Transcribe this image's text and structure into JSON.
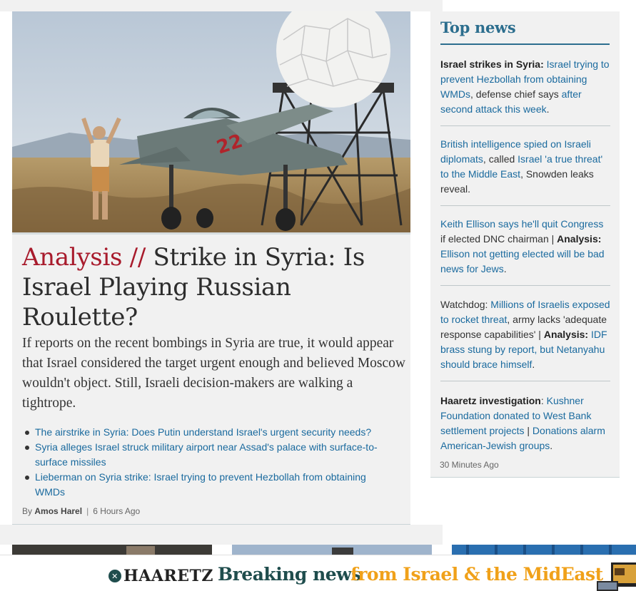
{
  "lead": {
    "kicker": "Analysis //",
    "title": " Strike in Syria: Is Israel Playing Russian Roulette?",
    "summary": "If reports on the recent bombings in Syria are true, it would appear that Israel considered the target urgent enough and believed Moscow wouldn't object. Still, Israeli decision-makers are walking a tightrope.",
    "related": [
      "The airstrike in Syria: Does Putin understand Israel's urgent security needs?",
      "Syria alleges Israel struck military airport near Assad's palace with surface-to-surface missiles",
      "Lieberman on Syria strike: Israel trying to prevent Hezbollah from obtaining WMDs"
    ],
    "byline_prefix": "By",
    "author": "Amos Harel",
    "time": "6 Hours Ago",
    "image_text": "22"
  },
  "topnews": {
    "title": "Top news",
    "items": [
      {
        "p1": "Israel strikes in Syria:",
        "p2": " Israel trying to prevent Hezbollah from obtaining WMDs",
        "p3": ", defense chief says ",
        "p4": "after second attack this week",
        "p5": "."
      },
      {
        "p1": "British intelligence spied on Israeli diplomats",
        "p2": ", called ",
        "p3": "Israel 'a true threat' to the Middle East",
        "p4": ", Snowden leaks reveal."
      },
      {
        "p1": "Keith Ellison says he'll quit Congress",
        "p2": " if elected DNC chairman | ",
        "p3": "Analysis:",
        "p4": " Ellison not getting elected will be bad news for Jews",
        "p5": "."
      },
      {
        "p1": "Watchdog: ",
        "p2": "Millions of Israelis exposed to rocket threat",
        "p3": ", army lacks 'adequate response capabilities' | ",
        "p4": "Analysis:",
        "p5": " IDF brass stung by report, but Netanyahu should brace himself",
        "p6": "."
      },
      {
        "p1": "Haaretz investigation",
        "p2": ": ",
        "p3": "Kushner Foundation donated to West Bank settlement projects",
        "p4": " | ",
        "p5": "Donations alarm American-Jewish groups",
        "p6": "."
      }
    ],
    "time": "30 Minutes Ago"
  },
  "banner": {
    "logo": "HAARETZ",
    "tagline_a": "Breaking news",
    "tagline_b": "from Israel & the MidEast"
  },
  "icons": [
    "haaretz-logo-icon",
    "tv-icon",
    "bullet-icon"
  ],
  "colors": {
    "kicker": "#a81b2c",
    "link": "#1a6a9e",
    "accent": "#2c6e8e",
    "banner_dark": "#1f4d4d",
    "banner_orange": "#f0a11a"
  }
}
